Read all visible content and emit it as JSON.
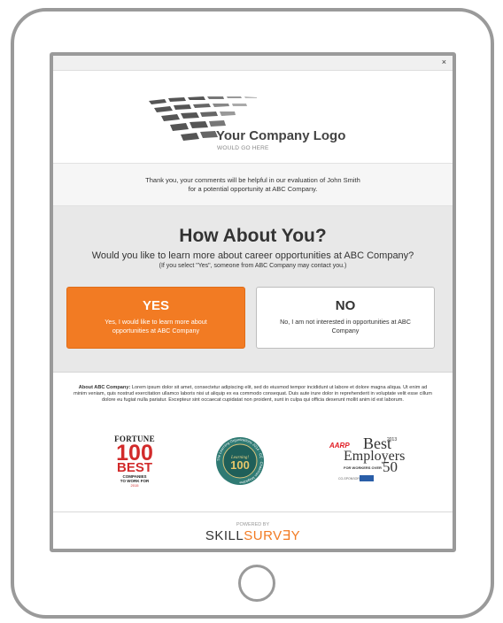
{
  "modal": {
    "close_label": "×"
  },
  "logo": {
    "title": "Your Company Logo",
    "subtitle": "WOULD GO HERE",
    "icon": "checkerboard-wave-logo"
  },
  "thanks": {
    "line1": "Thank you, your comments will be helpful in our evaluation of John Smith",
    "line2": "for a potential opportunity at ABC Company."
  },
  "question": {
    "heading": "How About You?",
    "text": "Would you like to learn more about career opportunities at ABC Company?",
    "note": "(If you select \"Yes\", someone from ABC Company may contact you.)"
  },
  "options": {
    "yes": {
      "title": "YES",
      "description": "Yes, I would like to learn more about opportunities at ABC Company",
      "color": "#f27b23"
    },
    "no": {
      "title": "NO",
      "description": "No, I am not interested in opportunities at ABC Company"
    }
  },
  "about": {
    "label": "About ABC Company:",
    "text": "Lorem ipsum dolor sit amet, consectetur adipiscing elit, sed do eiusmod tempor incididunt ut labore et dolore magna aliqua. Ut enim ad minim veniam, quis nostrud exercitation ullamco laboris nisi ut aliquip ex ea commodo consequat. Duis aute irure dolor in reprehenderit in voluptate velit esse cillum dolore eu fugiat nulla pariatur. Excepteur sint occaecat cupidatat non proident, sunt in culpa qui officia deserunt mollit anim id est laborum."
  },
  "awards": {
    "fortune": {
      "name": "FORTUNE",
      "number": "100",
      "best": "BEST",
      "sub1": "COMPANIES",
      "sub2": "TO WORK FOR",
      "year": "2015"
    },
    "learning": {
      "ring_text": "The Learning Organizations 2014 · CE · Chairman Magazine",
      "center_label": "Learning!",
      "number": "100"
    },
    "aarp": {
      "logo": "AARP",
      "year": "2013",
      "best": "Best",
      "employers": "Employers",
      "for_workers": "FOR WORKERS OVER",
      "age": "50",
      "sponsor": "CO-SPONSORED BY"
    }
  },
  "footer": {
    "powered_by": "POWERED BY",
    "brand_part1": "SKILL",
    "brand_part2": "SURV∃Y",
    "accent": "#f27b23"
  }
}
